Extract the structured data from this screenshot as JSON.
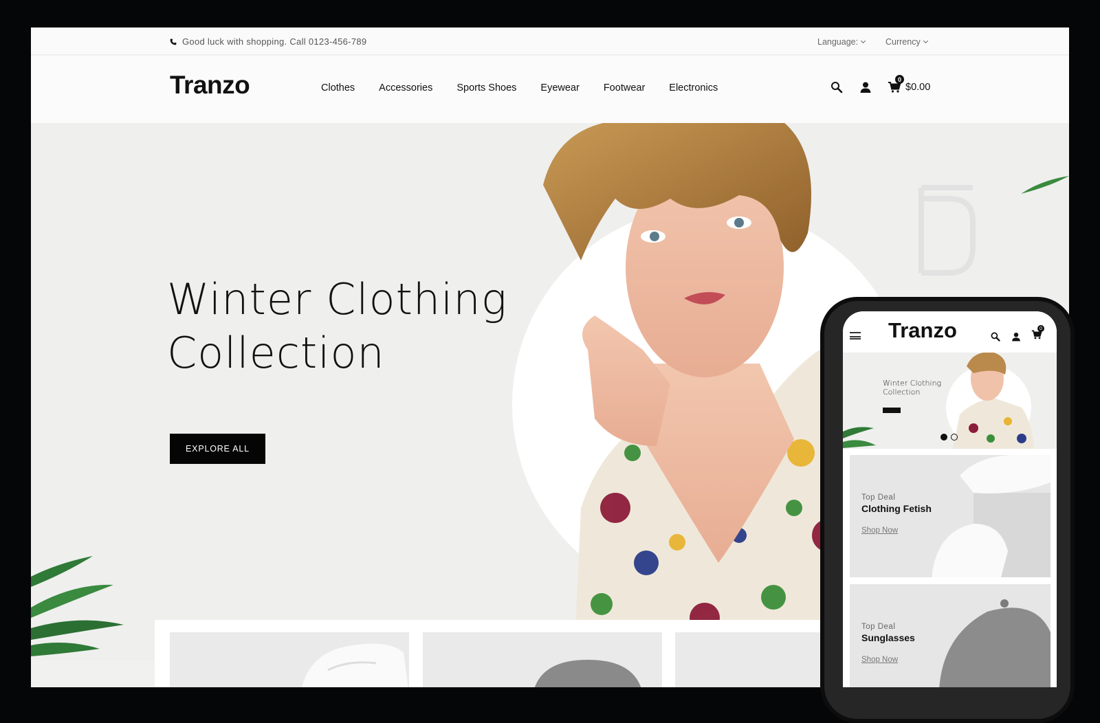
{
  "topbar": {
    "message": "Good luck with shopping. Call 0123-456-789",
    "language_label": "Language:",
    "currency_label": "Currency"
  },
  "header": {
    "logo": "Tranzo",
    "nav": [
      "Clothes",
      "Accessories",
      "Sports Shoes",
      "Eyewear",
      "Footwear",
      "Electronics"
    ],
    "cart_count": "0",
    "cart_total": "$0.00"
  },
  "hero": {
    "title_line1": "Winter Clothing",
    "title_line2": "Collection",
    "button": "EXPLORE ALL"
  },
  "mobile": {
    "logo": "Tranzo",
    "cart_count": "0",
    "hero_line1": "Winter Clothing",
    "hero_line2": "Collection",
    "deals": [
      {
        "label": "Top Deal",
        "name": "Clothing Fetish",
        "link": "Shop Now"
      },
      {
        "label": "Top Deal",
        "name": "Sunglasses",
        "link": "Shop Now"
      }
    ]
  },
  "colors": {
    "accent": "#050505",
    "hero_bg": "#efefee",
    "leaf": "#2f7a36"
  },
  "icons": [
    "phone-icon",
    "search-icon",
    "user-icon",
    "cart-icon",
    "menu-icon"
  ]
}
